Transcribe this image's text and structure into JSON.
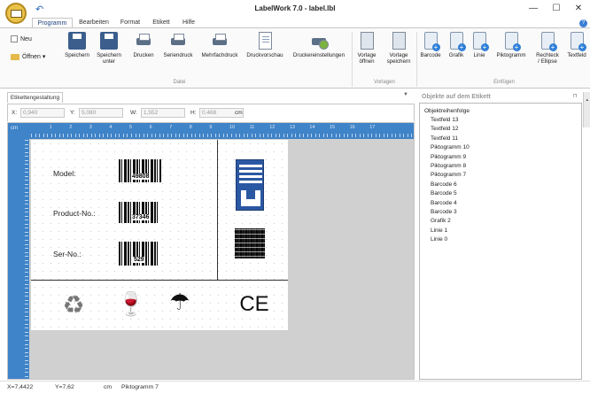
{
  "window": {
    "title": "LabelWork 7.0 - label.lbl",
    "minimize": "—",
    "maximize": "☐",
    "close": "✕"
  },
  "tabs": [
    "Programm",
    "Bearbeiten",
    "Format",
    "Etikett",
    "Hilfe"
  ],
  "ribbon": {
    "neu": "Neu",
    "oeffnen": "Öffnen",
    "speichern": "Speichern",
    "speichern_unter_1": "Speichern",
    "speichern_unter_2": "unter",
    "drucken": "Drucken",
    "seriendruck": "Seriendruck",
    "mehrfachdruck": "Mehrfachdruck",
    "druckvorschau": "Druckvorschau",
    "druckereinstellungen": "Druckereinstellungen",
    "vorlage_oeffnen_1": "Vorlage",
    "vorlage_oeffnen_2": "öffnen",
    "vorlage_speichern_1": "Vorlage",
    "vorlage_speichern_2": "speichern",
    "barcode": "Barcode",
    "grafik": "Grafik",
    "linie": "Linie",
    "piktogramm": "Piktogramm",
    "rechteck_1": "Rechteck",
    "rechteck_2": "/ Ellipse",
    "textfeld": "Textfeld",
    "group_datei": "Datei",
    "group_vorlagen": "Vorlagen",
    "group_einfuegen": "Einfügen"
  },
  "doc_tab": "Etikettengestaltung",
  "coords": {
    "x_label": "X:",
    "x_value": "0,940",
    "y_label": "Y:",
    "y_value": "5,080",
    "w_label": "W:",
    "w_value": "1,552",
    "h_label": "H:",
    "h_value": "0,468",
    "unit": "cm"
  },
  "ruler": {
    "corner": "cm",
    "top": [
      "1",
      "2",
      "3",
      "4",
      "5",
      "6",
      "7",
      "8",
      "9",
      "10",
      "11",
      "12",
      "13",
      "14",
      "15",
      "16",
      "17"
    ]
  },
  "label": {
    "model": "Model:",
    "product_no": "Product-No.:",
    "ser_no": "Ser-No.:",
    "bc1": "49808",
    "bc2": "37346",
    "bc3": "529",
    "ce": "CE"
  },
  "panel": {
    "title": "Objekte auf dem Etikett",
    "heading": "Objektreihenfolge",
    "items": [
      "Textfeld 13",
      "Textfeld 12",
      "Textfeld 11",
      "Piktogramm 10",
      "Piktogramm 9",
      "Piktogramm 8",
      "Piktogramm 7",
      "Barcode 6",
      "Barcode 5",
      "Barcode 4",
      "Barcode 3",
      "Grafik 2",
      "Linie 1",
      "Linie 0"
    ]
  },
  "status": {
    "x": "X=7,4422",
    "y": "Y=7,62",
    "unit": "cm",
    "selection": "Piktogramm 7"
  },
  "colors": {
    "accent": "#3f83c8",
    "ribbon_bg": "#fafafa",
    "canvas_bg": "#d0d0d0"
  }
}
